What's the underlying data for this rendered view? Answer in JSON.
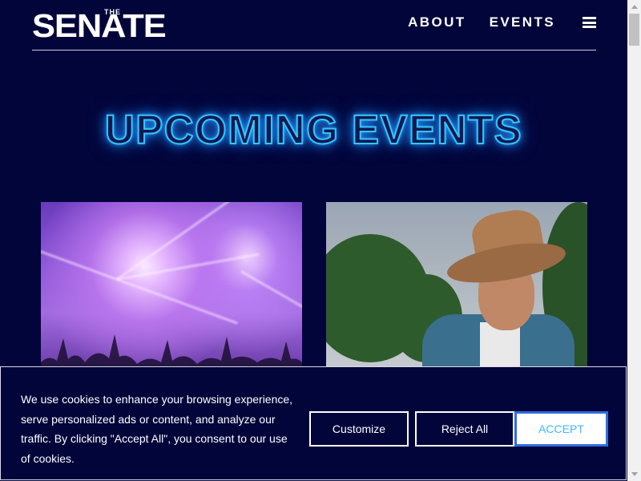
{
  "header": {
    "logo_small": "THE",
    "logo_main": "SENATE",
    "nav": [
      {
        "label": "ABOUT"
      },
      {
        "label": "EVENTS"
      }
    ],
    "menu_icon": "hamburger-icon"
  },
  "main": {
    "heading": "UPCOMING EVENTS",
    "events": [
      {
        "image": "concert-crowd-lights"
      },
      {
        "image": "smiling-man-in-hat"
      }
    ]
  },
  "cookie_banner": {
    "text": "We use cookies to enhance your browsing experience, serve personalized ads or content, and analyze our traffic. By clicking \"Accept All\", you consent to our use of cookies.",
    "customize_label": "Customize",
    "reject_label": "Reject All",
    "accept_label": "ACCEPT"
  },
  "colors": {
    "background": "#02053a",
    "neon": "#35c4ff",
    "accept_border": "#2f6de0",
    "accept_text": "#3eb7ff"
  }
}
